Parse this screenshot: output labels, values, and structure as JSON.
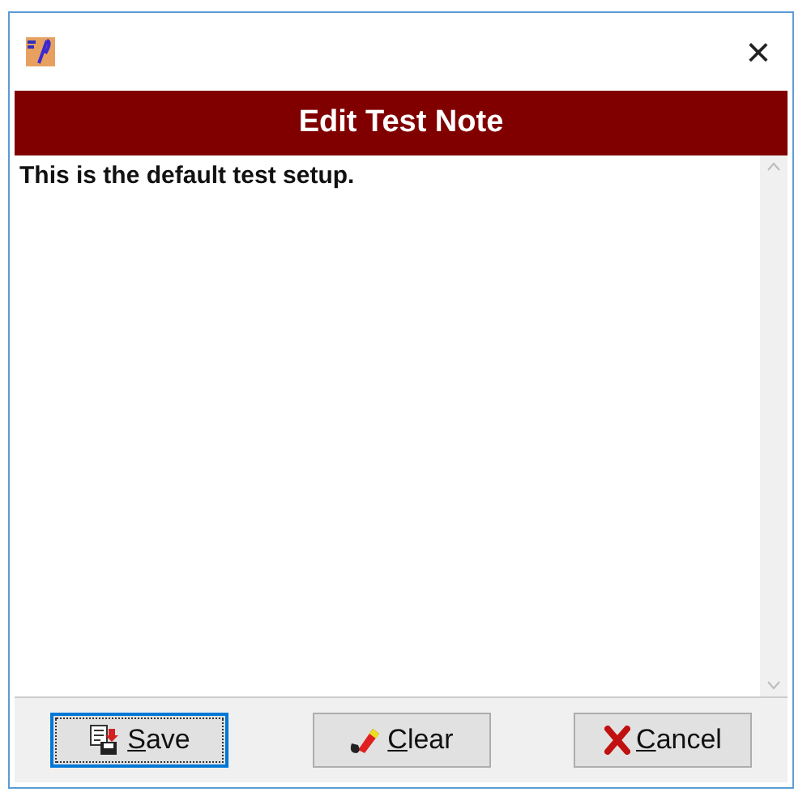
{
  "window": {
    "close_glyph": "×"
  },
  "header": {
    "title": "Edit Test Note"
  },
  "note": {
    "value": "This is the default test setup."
  },
  "buttons": [
    {
      "kind": "save",
      "label": "Save",
      "focused": true
    },
    {
      "kind": "clear",
      "label": "Clear",
      "focused": false
    },
    {
      "kind": "cancel",
      "label": "Cancel",
      "focused": false
    }
  ]
}
